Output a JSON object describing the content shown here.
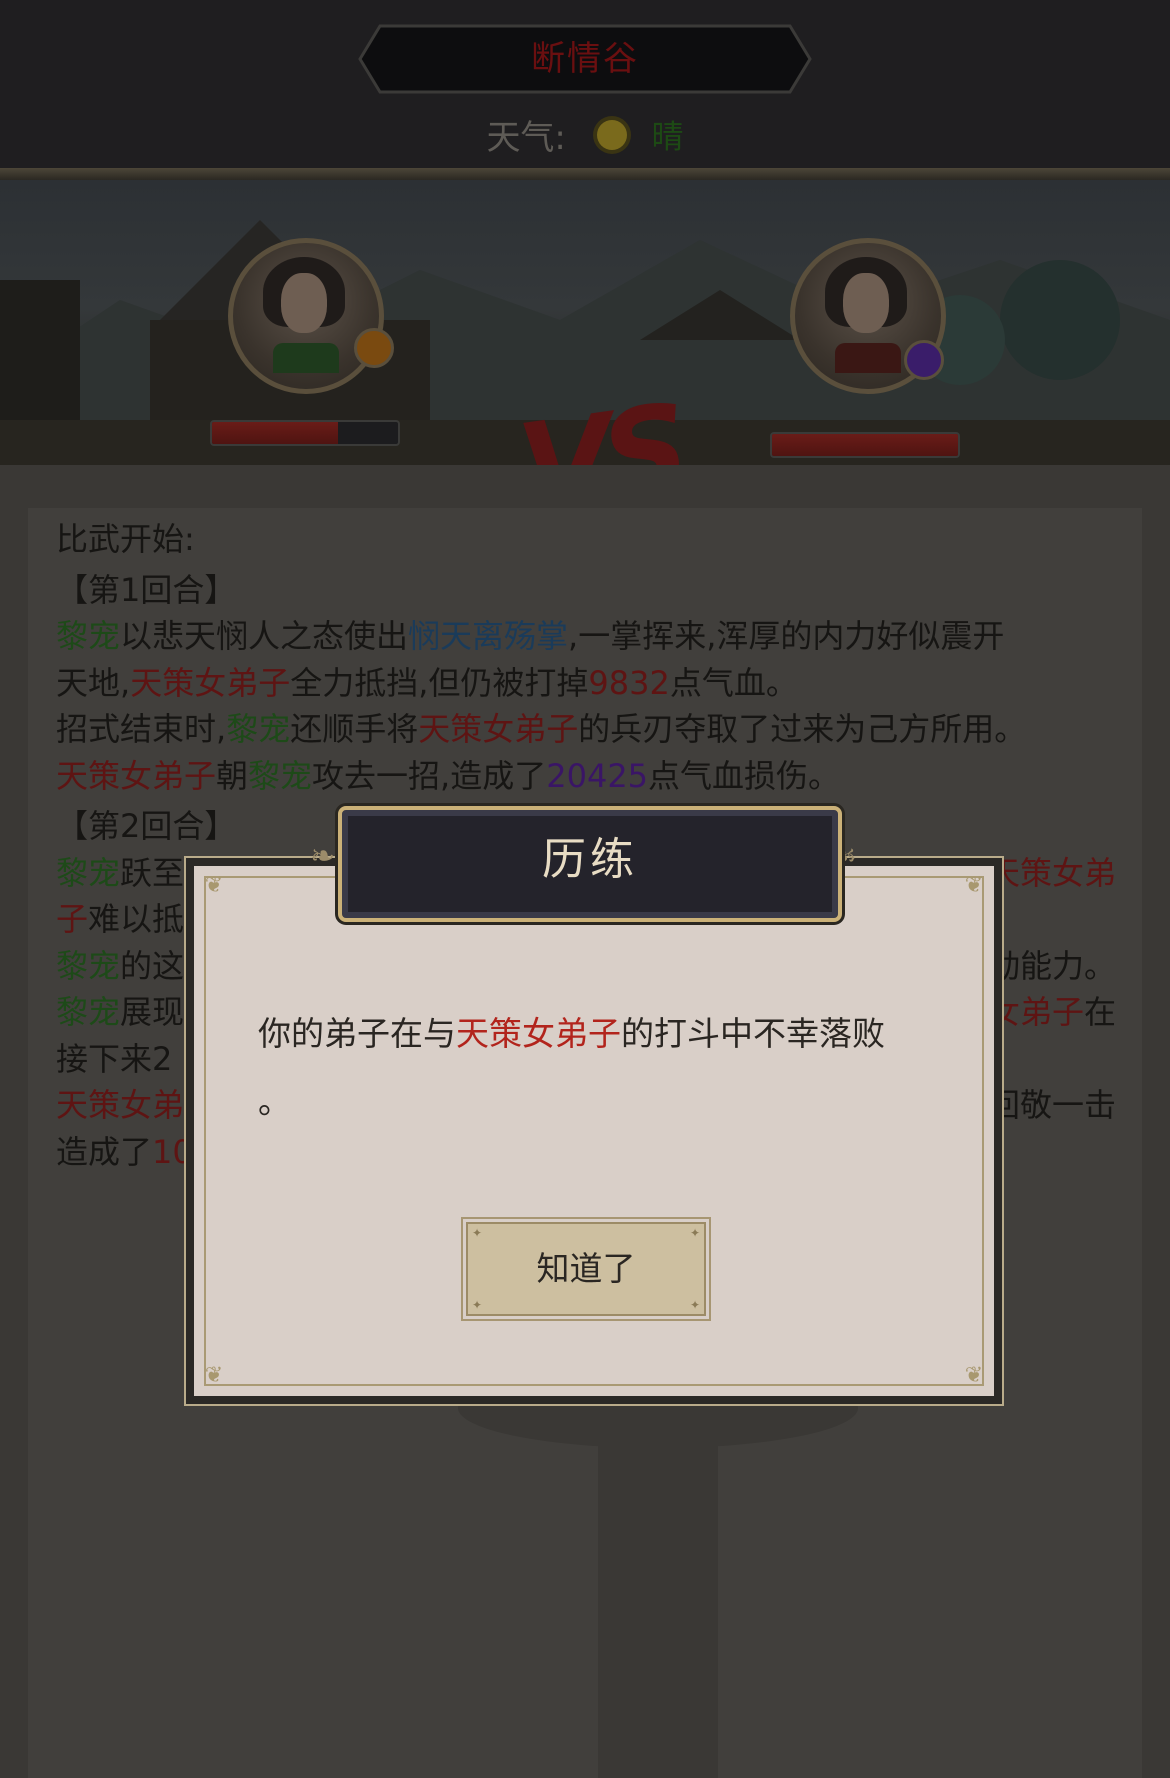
{
  "header": {
    "location_title": "断情谷",
    "weather_label": "天气:",
    "weather_icon": "sun-icon",
    "weather_value": "晴"
  },
  "battle": {
    "vs_label": "VS",
    "player": {
      "name": "黎宠",
      "hp_fraction": 0.68,
      "badge_color": "#7a4a10"
    },
    "enemy": {
      "name": "天策女弟子",
      "hp_fraction": 1.0,
      "badge_color": "#3a1d6a"
    }
  },
  "log": {
    "start": "比武开始:",
    "round1": "【第1回合】",
    "r1_l1": {
      "a": "黎宠",
      "b": "以悲天悯人之态使出",
      "c": "悯天离殇掌",
      "d": ",一掌挥来,浑厚的内力好似震开"
    },
    "r1_l2": {
      "a": "天地,",
      "b": "天策女弟子",
      "c": "全力抵挡,但仍被打掉",
      "d": "9832",
      "e": "点气血。"
    },
    "r1_l3": {
      "a": "招式结束时,",
      "b": "黎宠",
      "c": "还顺手将",
      "d": "天策女弟子",
      "e": "的兵刃夺取了过来为己方所用。"
    },
    "r1_l4": {
      "a": "天策女弟子",
      "b": "朝",
      "c": "黎宠",
      "d": "攻去一招,造成了",
      "e": "20425",
      "f": "点气血损伤。"
    },
    "round2": "【第2回合】",
    "r2_l1": {
      "a": "黎宠",
      "b": "跃至",
      "c": "天策女弟"
    },
    "r2_l2": {
      "a": "子",
      "b": "难以抵"
    },
    "r2_l3": {
      "a": "黎宠",
      "b": "的这",
      "c": "动能力。"
    },
    "r2_l4": {
      "a": "黎宠",
      "b": "展现",
      "c": "女弟子",
      "d": "在"
    },
    "r2_l5": {
      "a": "接下来2",
      "b": ""
    },
    "r2_l6": {
      "a": "天策女弟",
      "b": "回敬一击"
    },
    "r2_l7": {
      "a": "造成了",
      "b": "10",
      "c": "。"
    }
  },
  "dialog": {
    "title": "历练",
    "message_prefix": "你的弟子在与",
    "message_enemy": "天策女弟子",
    "message_suffix": "的打斗中不幸落败",
    "message_end": "。",
    "ok_button": "知道了"
  },
  "colors": {
    "ally_name": "#1d4a18",
    "enemy_name": "#5e1413",
    "skill_name": "#1a3b5a",
    "damage_taken": "#3a1566",
    "dialog_enemy": "#b2241c"
  }
}
